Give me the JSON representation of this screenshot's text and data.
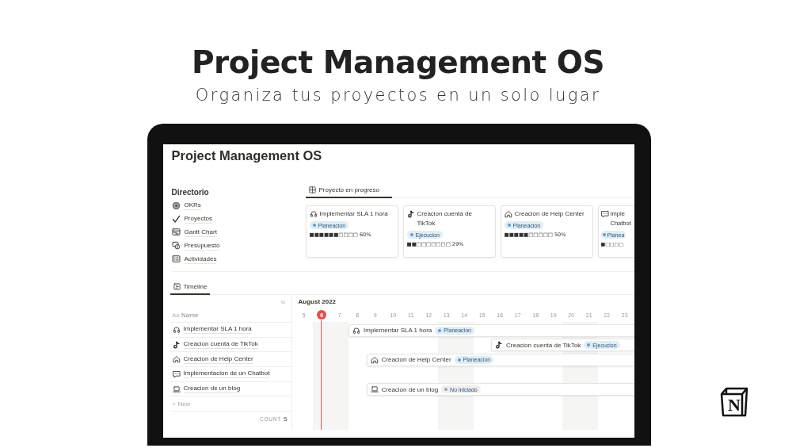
{
  "header": {
    "title": "Project Management OS",
    "subtitle": "Organiza tus proyectos en un solo lugar"
  },
  "logo": {
    "letter": "N"
  },
  "page": {
    "title": "Project Management OS",
    "directory": {
      "heading": "Directorio",
      "items": [
        {
          "label": "OKRs"
        },
        {
          "label": "Proyectos"
        },
        {
          "label": "Gantt Chart"
        },
        {
          "label": "Presupuesto"
        },
        {
          "label": "Actividades"
        }
      ]
    },
    "gallery": {
      "tab": {
        "label": "Proyecto en progreso",
        "selected": true
      },
      "cards": [
        {
          "title": "Implementar SLA 1 hora",
          "status": {
            "label": "Planeacion",
            "color": "#5e9fca"
          },
          "progress": "■■■■■■□□□□ 60%",
          "clipped": false
        },
        {
          "title": "Creacion cuenta de TikTok",
          "status": {
            "label": "Ejecucion",
            "color": "#5e9fca"
          },
          "progress": "■■□□□□□□□ 29%",
          "clipped": false
        },
        {
          "title": "Creacion de Help Center",
          "status": {
            "label": "Planeacion",
            "color": "#5e9fca"
          },
          "progress": "■■■■■□□□□□ 50%",
          "clipped": false
        },
        {
          "title": "Imple Chatbot",
          "status": {
            "label": "Planea",
            "color": "#5e9fca"
          },
          "progress": "■□□□□",
          "clipped": true
        }
      ]
    },
    "timeline": {
      "tab": {
        "label": "Timeline",
        "selected": true
      },
      "collapse": "«",
      "name_icon": "Aa",
      "name_header": "Name",
      "month": "August 2022",
      "days": [
        {
          "label": "5",
          "today": false,
          "weekend": false
        },
        {
          "label": "6",
          "today": true,
          "weekend": true
        },
        {
          "label": "7",
          "today": false,
          "weekend": true
        },
        {
          "label": "8",
          "today": false,
          "weekend": false
        },
        {
          "label": "9",
          "today": false,
          "weekend": false
        },
        {
          "label": "10",
          "today": false,
          "weekend": false
        },
        {
          "label": "11",
          "today": false,
          "weekend": false
        },
        {
          "label": "12",
          "today": false,
          "weekend": false
        },
        {
          "label": "13",
          "today": false,
          "weekend": true
        },
        {
          "label": "14",
          "today": false,
          "weekend": true
        },
        {
          "label": "15",
          "today": false,
          "weekend": false
        },
        {
          "label": "16",
          "today": false,
          "weekend": false
        },
        {
          "label": "17",
          "today": false,
          "weekend": false
        },
        {
          "label": "18",
          "today": false,
          "weekend": false
        },
        {
          "label": "19",
          "today": false,
          "weekend": false
        },
        {
          "label": "20",
          "today": false,
          "weekend": true
        },
        {
          "label": "21",
          "today": false,
          "weekend": true
        },
        {
          "label": "22",
          "today": false,
          "weekend": false
        },
        {
          "label": "23",
          "today": false,
          "weekend": false
        }
      ],
      "rows": [
        {
          "name": "Implementar SLA 1 hora",
          "bar": {
            "title": "Implementar SLA 1 hora",
            "status": {
              "label": "Planeacion",
              "color": "#5e9fca"
            }
          }
        },
        {
          "name": "Creacion cuenta de TikTok",
          "bar": {
            "title": "Creacion cuenta de TikTok",
            "status": {
              "label": "Ejecucion",
              "color": "#5e9fca"
            }
          }
        },
        {
          "name": "Creacion de Help Center",
          "bar": {
            "title": "Creacion de Help Center",
            "status": {
              "label": "Planeacion",
              "color": "#5e9fca"
            }
          }
        },
        {
          "name": "Implementacion de un Chatbot"
        },
        {
          "name": "Creacion de un blog",
          "bar": {
            "title": "Creacion de un blog",
            "status": {
              "label": "No iniciado",
              "color": "#a5a4a0"
            }
          }
        }
      ],
      "new": "+ New",
      "count_label": "COUNT",
      "count": "5"
    }
  }
}
